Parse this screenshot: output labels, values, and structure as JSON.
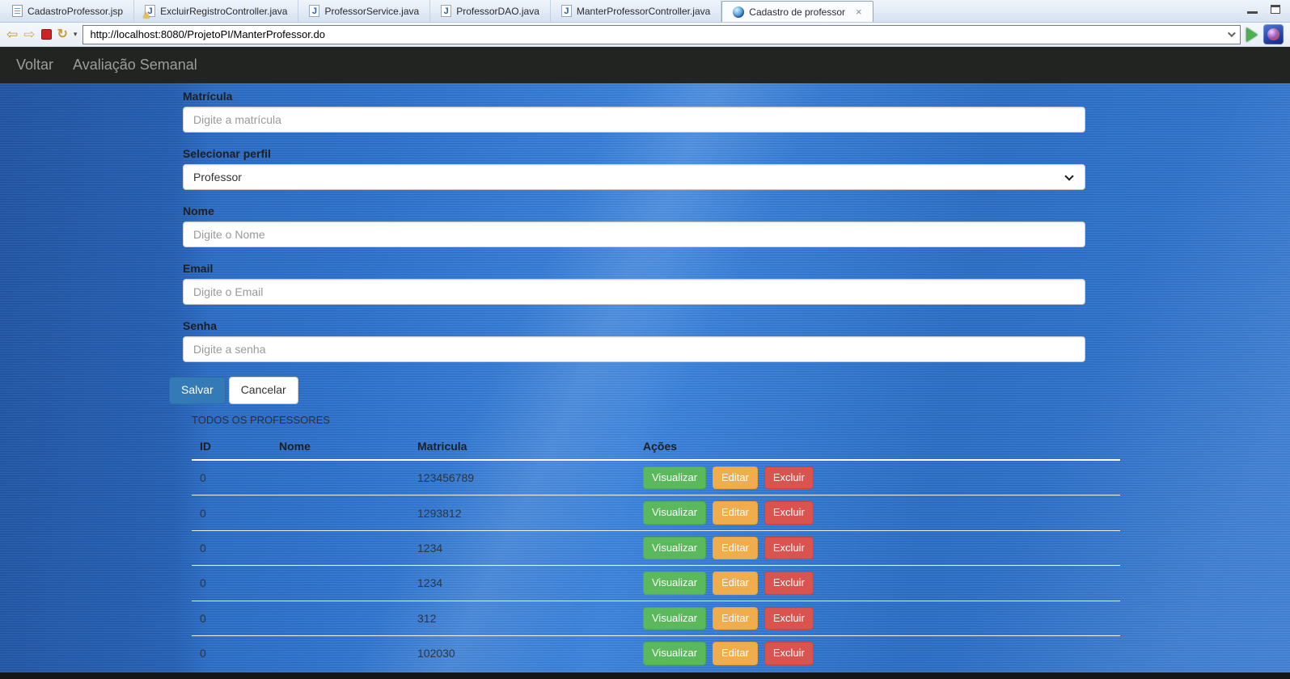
{
  "ide": {
    "tabs": [
      {
        "label": "CadastroProfessor.jsp"
      },
      {
        "label": "ExcluirRegistroController.java"
      },
      {
        "label": "ProfessorService.java"
      },
      {
        "label": "ProfessorDAO.java"
      },
      {
        "label": "ManterProfessorController.java"
      },
      {
        "label": "Cadastro de professor"
      }
    ],
    "active_tab_close": "×"
  },
  "toolbar": {
    "url": "http://localhost:8080/ProjetoPI/ManterProfessor.do",
    "back_glyph": "⇦",
    "forward_glyph": "⇨",
    "refresh_glyph": "↻",
    "caret_glyph": "▾"
  },
  "navbar": {
    "links": [
      {
        "label": "Voltar"
      },
      {
        "label": "Avaliação Semanal"
      }
    ]
  },
  "form": {
    "matricula": {
      "label": "Matrícula",
      "placeholder": "Digite a matrícula"
    },
    "perfil": {
      "label": "Selecionar perfil",
      "value": "Professor"
    },
    "nome": {
      "label": "Nome",
      "placeholder": "Digite o Nome"
    },
    "email": {
      "label": "Email",
      "placeholder": "Digite o Email"
    },
    "senha": {
      "label": "Senha",
      "placeholder": "Digite a senha"
    },
    "save_label": "Salvar",
    "cancel_label": "Cancelar"
  },
  "professors": {
    "caption": "TODOS OS PROFESSORES",
    "headers": {
      "id": "ID",
      "nome": "Nome",
      "matricula": "Matricula",
      "acoes": "Ações"
    },
    "action_labels": {
      "view": "Visualizar",
      "edit": "Editar",
      "delete": "Excluir"
    },
    "rows": [
      {
        "id": "0",
        "nome": "",
        "matricula": "123456789"
      },
      {
        "id": "0",
        "nome": "",
        "matricula": "1293812"
      },
      {
        "id": "0",
        "nome": "",
        "matricula": "1234"
      },
      {
        "id": "0",
        "nome": "",
        "matricula": "1234"
      },
      {
        "id": "0",
        "nome": "",
        "matricula": "312"
      },
      {
        "id": "0",
        "nome": "",
        "matricula": "102030"
      }
    ]
  },
  "colors": {
    "accent_primary": "#337ab7",
    "success": "#5cb85c",
    "warning": "#f0ad4e",
    "danger": "#d9534f",
    "navbar_bg": "#212421",
    "nav_link": "#9d9d9d",
    "background_blue": "#3579d2"
  }
}
